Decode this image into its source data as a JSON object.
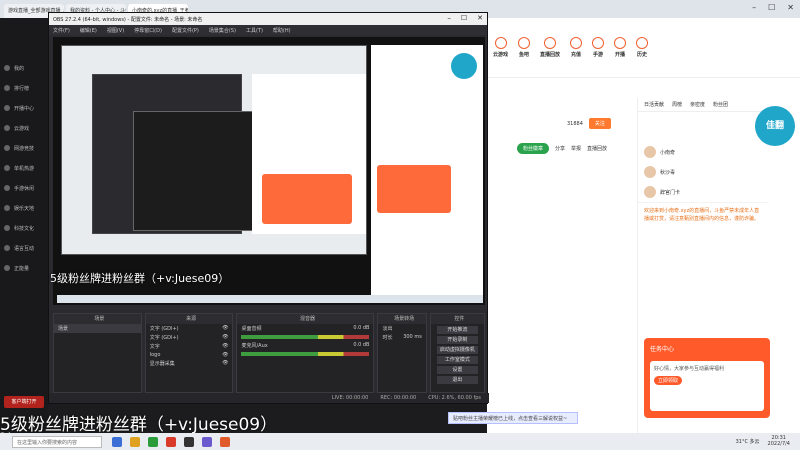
{
  "browser": {
    "tabs": [
      "游戏直播_全部游戏直播_斗鱼直...",
      "我的资料 - 个人中心 - 斗鱼...",
      "小南奇的.xyz的直播_王者荣耀直播..."
    ]
  },
  "sidebar": {
    "items": [
      "我的",
      "排行榜",
      "开播中心",
      "云游戏",
      "网游竞技",
      "单机热游",
      "手游休闲",
      "娱乐天地",
      "科技文化",
      "语言互动",
      "正能量"
    ],
    "bottom_buttons": [
      "客户端打开",
      "下载APP"
    ]
  },
  "obs": {
    "title": "OBS 27.2.4 (64-bit, windows) - 配置文件: 未命名 - 场景: 未命名",
    "menu": [
      "文件(F)",
      "编辑(E)",
      "视图(V)",
      "停靠窗口(D)",
      "配置文件(P)",
      "场景集合(S)",
      "工具(T)",
      "帮助(H)"
    ],
    "docks": {
      "scenes": "场景",
      "sources": "来源",
      "mixer": "混音器",
      "transitions": "场景转场",
      "controls": "控件"
    },
    "scenes_list": [
      "场景"
    ],
    "sources_list": [
      "文字 (GDI+)",
      "文字 (GDI+)",
      "文字",
      "logo",
      "显示器采集"
    ],
    "mixer_channels": [
      {
        "name": "桌面音频",
        "db": "0.0 dB"
      },
      {
        "name": "麦克风/Aux",
        "db": "0.0 dB"
      }
    ],
    "transition": {
      "type": "淡出",
      "duration_label": "时长",
      "duration": "300 ms"
    },
    "controls": [
      "开始推流",
      "开始录制",
      "启动虚拟摄像机",
      "工作室模式",
      "设置",
      "退出"
    ],
    "status": [
      "LIVE: 00:00:00",
      "REC: 00:00:00",
      "CPU: 2.6%, 60.00 fps"
    ]
  },
  "site": {
    "nav": [
      "云游戏",
      "鱼吧",
      "直播回放",
      "充值",
      "手游",
      "开播",
      "历史"
    ],
    "follow_label": "关注",
    "heat": "31884",
    "green_pill": "粉丝徽章",
    "orange_pill": "客户端",
    "actions": [
      "分享",
      "举报",
      "直播回放"
    ],
    "chat_tabs": [
      "日活贡献",
      "周榜",
      "亲密度",
      "粉丝团"
    ],
    "chat_rows": [
      "小南奇",
      "秋沙毒",
      "辞官门卡"
    ],
    "welcome_text": "欢迎来到小南奇.xyz的直播间，斗鱼严禁未成年人直播或打赏，请注意甄别直播间内的信息，谨防诈骗。",
    "badge_text": "佳翻",
    "promo_title": "任务中心",
    "promo_body": "好心情，大家参与互动赢得福利",
    "promo_button": "立即领取",
    "hint": "贴吧粉丝主播荣耀榜已上线，点击查看三解说权益~"
  },
  "overlay": {
    "caption_small": "5级粉丝牌进粉丝群（+v:Juese09）",
    "caption_big": "5级粉丝牌进粉丝群（+v:Juese09）",
    "counter": "24"
  },
  "taskbar": {
    "search_placeholder": "在这里输入你要搜索的内容",
    "weather": "31°C 多云",
    "time": "20:31",
    "date": "2022/7/4"
  }
}
